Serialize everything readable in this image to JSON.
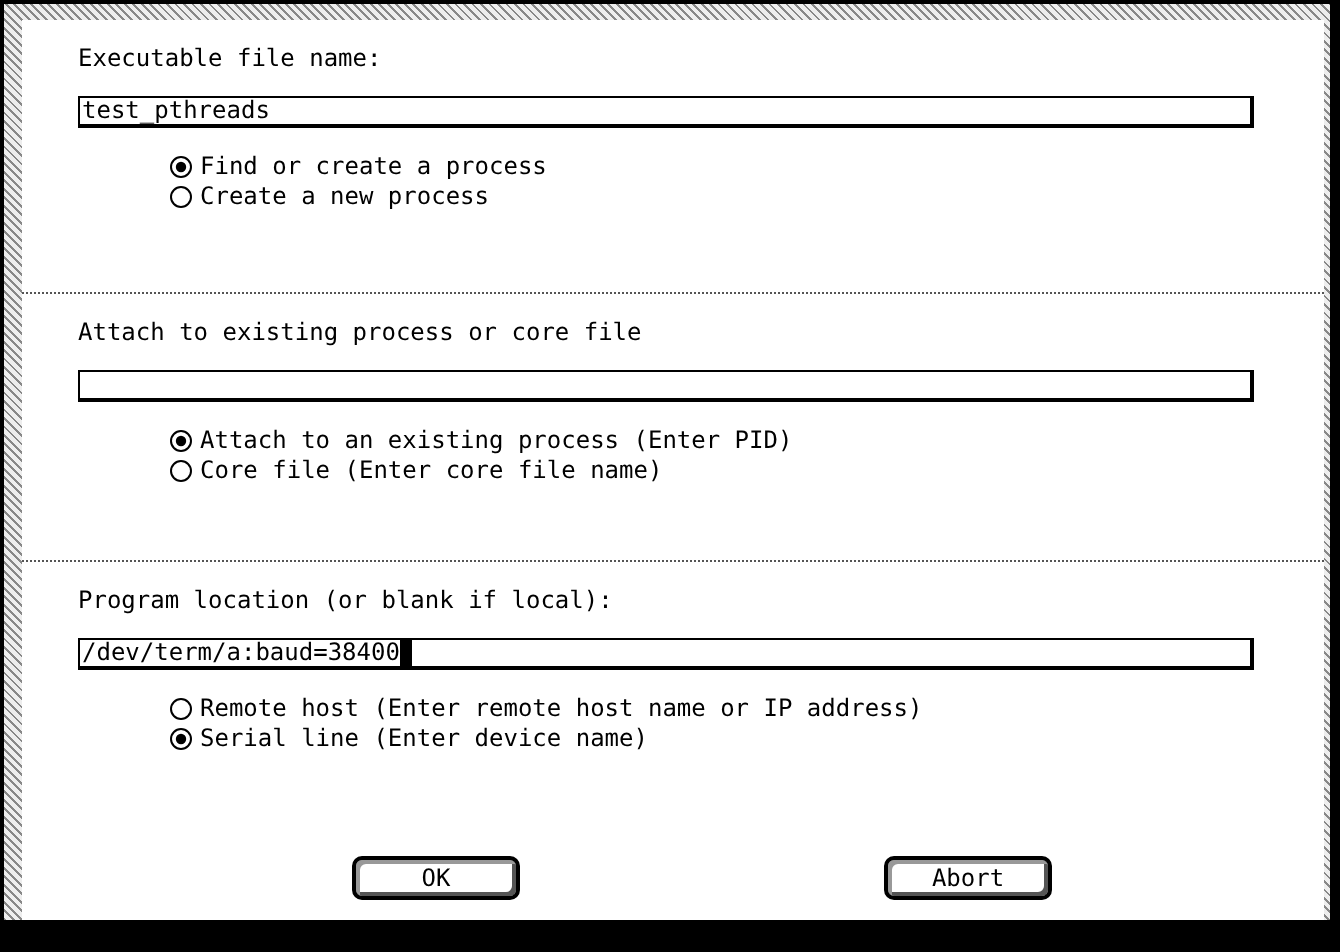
{
  "sections": [
    {
      "label": "Executable file name:",
      "field": {
        "value": "test_pthreads",
        "focused": false
      },
      "options": [
        {
          "label": "Find or create a process",
          "selected": true
        },
        {
          "label": "Create a new process",
          "selected": false
        }
      ]
    },
    {
      "label": "Attach to existing process or core file",
      "field": {
        "focused": false
      },
      "options": [
        {
          "label": "Attach to an existing process (Enter PID)",
          "selected": true
        },
        {
          "label": "Core file (Enter core file name)",
          "selected": false
        }
      ]
    },
    {
      "label": "Program location (or blank if local):",
      "field": {
        "value": "/dev/term/a:baud=38400",
        "focused": true
      },
      "options": [
        {
          "label": "Remote host (Enter remote host name or IP address)",
          "selected": false
        },
        {
          "label": "Serial line (Enter device name)",
          "selected": true
        }
      ]
    }
  ],
  "buttons": [
    "OK",
    "Abort"
  ]
}
